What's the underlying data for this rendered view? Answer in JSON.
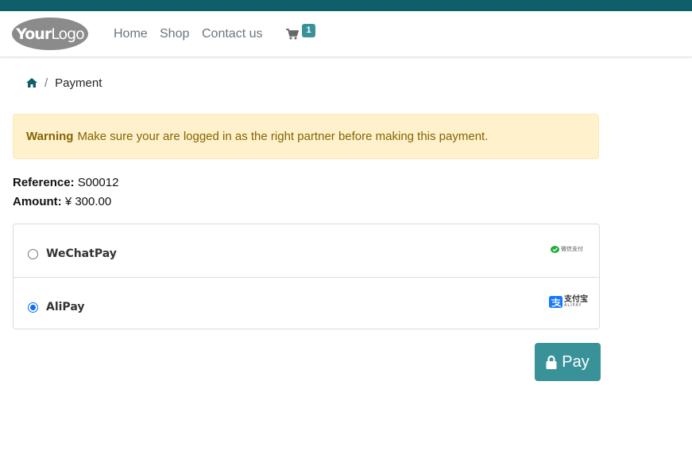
{
  "nav": {
    "logo": {
      "part1": "Your",
      "part2": "Logo"
    },
    "links": [
      "Home",
      "Shop",
      "Contact us"
    ],
    "cart_count": "1"
  },
  "breadcrumb": {
    "current": "Payment"
  },
  "alert": {
    "strong": "Warning",
    "text": "Make sure your are logged in as the right partner before making this payment."
  },
  "order": {
    "reference_label": "Reference:",
    "reference_value": "S00012",
    "amount_label": "Amount:",
    "amount_value": "¥ 300.00"
  },
  "payment_methods": [
    {
      "label": "WeChatPay",
      "logo_text": "微信支付",
      "selected": false
    },
    {
      "label": "AliPay",
      "logo_text": "支付宝",
      "logo_subtext": "ALIPAY",
      "selected": true
    }
  ],
  "pay_button": {
    "label": "Pay"
  },
  "colors": {
    "topbar": "#0f5f6b",
    "accent": "#3a9299",
    "warning_bg": "#fef1cc",
    "warning_text": "#856404"
  }
}
